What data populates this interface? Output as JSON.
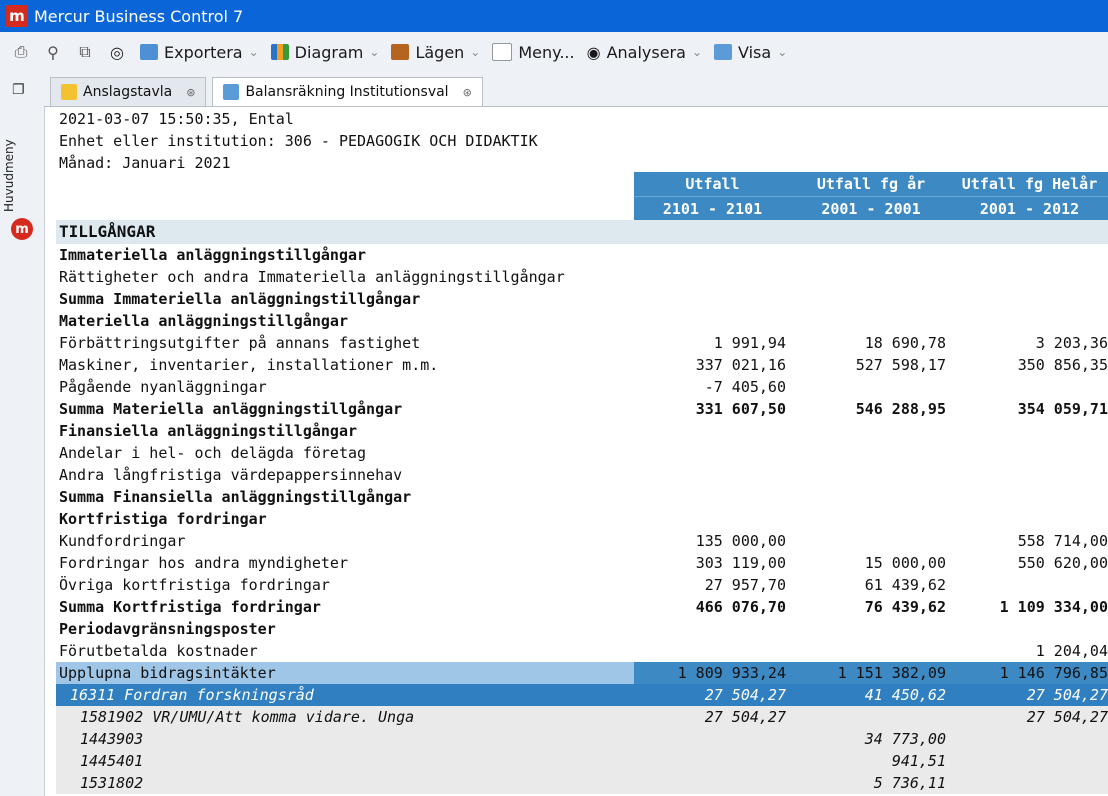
{
  "window": {
    "title": "Mercur Business Control 7",
    "logo_letter": "m"
  },
  "toolbar": {
    "exportera": "Exportera",
    "diagram": "Diagram",
    "lagen": "Lägen",
    "meny": "Meny...",
    "analysera": "Analysera",
    "visa": "Visa"
  },
  "sidebar": {
    "label": "Huvudmeny"
  },
  "tabs": [
    {
      "label": "Anslagstavla"
    },
    {
      "label": "Balansräkning Institutionsval"
    }
  ],
  "report": {
    "meta": [
      "2021-03-07 15:50:35, Ental",
      "Enhet eller institution: 306 - PEDAGOGIK OCH DIDAKTIK",
      "Månad: Januari 2021"
    ],
    "columns": [
      {
        "title": "Utfall",
        "period": "2101 - 2101"
      },
      {
        "title": "Utfall fg år",
        "period": "2001 - 2001"
      },
      {
        "title": "Utfall fg Helår",
        "period": "2001 - 2012"
      }
    ],
    "rows": [
      {
        "style": "section",
        "label": "TILLGÅNGAR",
        "values": [
          "",
          "",
          ""
        ]
      },
      {
        "style": "bold",
        "label": "Immateriella anläggningstillgångar",
        "values": [
          "",
          "",
          ""
        ]
      },
      {
        "style": "normal",
        "label": "Rättigheter och andra Immateriella anläggningstillgångar",
        "values": [
          "",
          "",
          ""
        ]
      },
      {
        "style": "bold",
        "label": "Summa Immateriella anläggningstillgångar",
        "values": [
          "",
          "",
          ""
        ]
      },
      {
        "style": "bold",
        "label": "Materiella anläggningstillgångar",
        "values": [
          "",
          "",
          ""
        ]
      },
      {
        "style": "normal",
        "label": "Förbättringsutgifter på annans fastighet",
        "values": [
          "1 991,94",
          "18 690,78",
          "3 203,36"
        ]
      },
      {
        "style": "normal",
        "label": "Maskiner, inventarier, installationer m.m.",
        "values": [
          "337 021,16",
          "527 598,17",
          "350 856,35"
        ]
      },
      {
        "style": "normal",
        "label": "Pågående nyanläggningar",
        "values": [
          "-7 405,60",
          "",
          ""
        ]
      },
      {
        "style": "bold",
        "label": "Summa Materiella anläggningstillgångar",
        "values": [
          "331 607,50",
          "546 288,95",
          "354 059,71"
        ]
      },
      {
        "style": "bold",
        "label": "Finansiella anläggningstillgångar",
        "values": [
          "",
          "",
          ""
        ]
      },
      {
        "style": "normal",
        "label": "Andelar i hel- och delägda företag",
        "values": [
          "",
          "",
          ""
        ]
      },
      {
        "style": "normal",
        "label": "Andra långfristiga värdepappersinnehav",
        "values": [
          "",
          "",
          ""
        ]
      },
      {
        "style": "bold",
        "label": "Summa Finansiella anläggningstillgångar",
        "values": [
          "",
          "",
          ""
        ]
      },
      {
        "style": "bold",
        "label": "Kortfristiga fordringar",
        "values": [
          "",
          "",
          ""
        ]
      },
      {
        "style": "normal",
        "label": "Kundfordringar",
        "values": [
          "135 000,00",
          "",
          "558 714,00"
        ]
      },
      {
        "style": "normal",
        "label": "Fordringar hos andra myndigheter",
        "values": [
          "303 119,00",
          "15 000,00",
          "550 620,00"
        ]
      },
      {
        "style": "normal",
        "label": "Övriga kortfristiga fordringar",
        "values": [
          "27 957,70",
          "61 439,62",
          ""
        ]
      },
      {
        "style": "bold",
        "label": "Summa Kortfristiga fordringar",
        "values": [
          "466 076,70",
          "76 439,62",
          "1 109 334,00"
        ]
      },
      {
        "style": "bold",
        "label": "Periodavgränsningsposter",
        "values": [
          "",
          "",
          ""
        ]
      },
      {
        "style": "normal",
        "label": "Förutbetalda kostnader",
        "values": [
          "",
          "",
          "1 204,04"
        ]
      },
      {
        "style": "sel",
        "label": "Upplupna bidragsintäkter",
        "values": [
          "1 809 933,24",
          "1 151 382,09",
          "1 146 796,85"
        ]
      },
      {
        "style": "sub",
        "label": "16311 Fordran forskningsråd",
        "values": [
          "27 504,27",
          "41 450,62",
          "27 504,27"
        ]
      },
      {
        "style": "detail",
        "label": "1581902 VR/UMU/Att komma vidare. Unga",
        "values": [
          "27 504,27",
          "",
          "27 504,27"
        ]
      },
      {
        "style": "detail",
        "label": "1443903",
        "values": [
          "",
          "34 773,00",
          ""
        ]
      },
      {
        "style": "detail",
        "label": "1445401",
        "values": [
          "",
          "941,51",
          ""
        ]
      },
      {
        "style": "detail",
        "label": "1531802",
        "values": [
          "",
          "5 736,11",
          ""
        ]
      }
    ]
  }
}
